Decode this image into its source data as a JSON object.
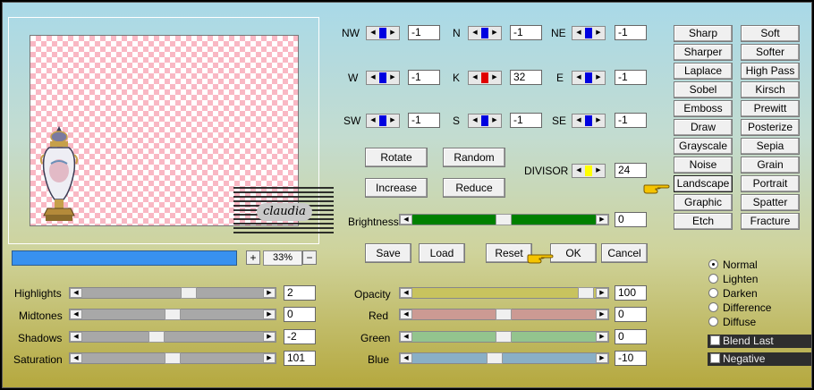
{
  "preview": {
    "watermark_text": "claudia"
  },
  "zoom": {
    "plus": "+",
    "minus": "−",
    "value": "33%"
  },
  "left_sliders": [
    {
      "label": "Highlights",
      "value": "2",
      "pos": 0.58
    },
    {
      "label": "Midtones",
      "value": "0",
      "pos": 0.5
    },
    {
      "label": "Shadows",
      "value": "-2",
      "pos": 0.42
    },
    {
      "label": "Saturation",
      "value": "101",
      "pos": 0.5
    }
  ],
  "matrix": {
    "rows": [
      [
        {
          "label": "NW",
          "value": "-1"
        },
        {
          "label": "N",
          "value": "-1"
        },
        {
          "label": "NE",
          "value": "-1"
        }
      ],
      [
        {
          "label": "W",
          "value": "-1"
        },
        {
          "label": "K",
          "value": "32"
        },
        {
          "label": "E",
          "value": "-1"
        }
      ],
      [
        {
          "label": "SW",
          "value": "-1"
        },
        {
          "label": "S",
          "value": "-1"
        },
        {
          "label": "SE",
          "value": "-1"
        }
      ]
    ],
    "accent_blue": "#0000e0",
    "accent_red": "#e00000"
  },
  "buttons": {
    "rotate": "Rotate",
    "random": "Random",
    "increase": "Increase",
    "reduce": "Reduce",
    "save": "Save",
    "load": "Load",
    "reset": "Reset",
    "ok": "OK",
    "cancel": "Cancel"
  },
  "divisor": {
    "label": "DIVISOR",
    "value": "24",
    "accent": "#ffff00"
  },
  "brightness": {
    "label": "Brightness",
    "value": "0",
    "track_color": "#008000"
  },
  "right_sliders": [
    {
      "label": "Opacity",
      "value": "100",
      "color": "#c8c35e",
      "pos": 0.98
    },
    {
      "label": "Red",
      "value": "0",
      "color": "#cc9a93",
      "pos": 0.5
    },
    {
      "label": "Green",
      "value": "0",
      "color": "#93c48e",
      "pos": 0.5
    },
    {
      "label": "Blue",
      "value": "-10",
      "color": "#8aafc6",
      "pos": 0.45
    }
  ],
  "presets": [
    [
      "Sharp",
      "Soft"
    ],
    [
      "Sharper",
      "Softer"
    ],
    [
      "Laplace",
      "High Pass"
    ],
    [
      "Sobel",
      "Kirsch"
    ],
    [
      "Emboss",
      "Prewitt"
    ],
    [
      "Draw",
      "Posterize"
    ],
    [
      "Grayscale",
      "Sepia"
    ],
    [
      "Noise",
      "Grain"
    ],
    [
      "Landscape",
      "Portrait"
    ],
    [
      "Graphic",
      "Spatter"
    ],
    [
      "Etch",
      "Fracture"
    ]
  ],
  "selected_preset": "Landscape",
  "blend_modes": [
    "Normal",
    "Lighten",
    "Darken",
    "Difference",
    "Diffuse"
  ],
  "selected_blend": "Normal",
  "checks": [
    "Blend Last",
    "Negative"
  ],
  "icons": {
    "pointer": "pointing-hand-icon"
  }
}
